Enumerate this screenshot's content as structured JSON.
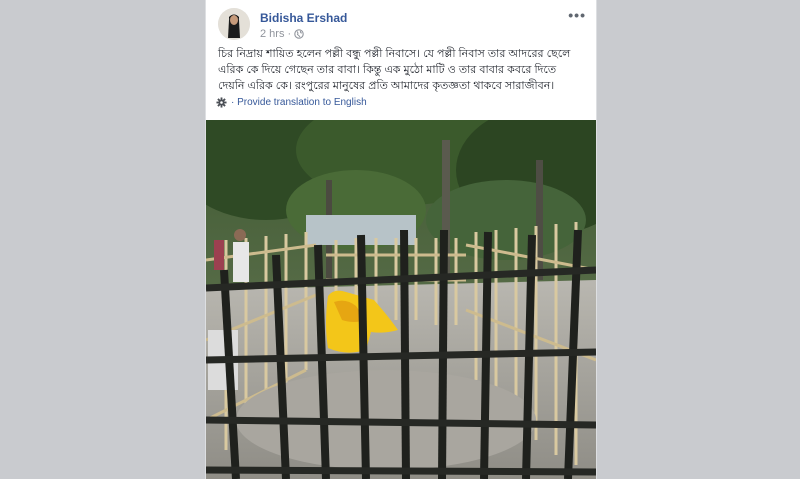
{
  "post": {
    "author": "Bidisha Ershad",
    "time": "2 hrs ·",
    "more_label": "•••",
    "text": "চির নিদ্রায় শায়িত হলেন পল্লী বন্ধু পল্লী নিবাসে। যে পল্লী নিবাস তার আদরের ছেলে এরিক কে দিয়ে গেছেন তার বাবা। কিন্তু এক মুঠো মাটি ও তার বাবার কবরে দিতে দেয়নি এরিক কে। রংপুরের মানুষের প্রতি আমাদের কৃতজ্ঞতা থাকবে সারাজীবন।",
    "translate_label": "· Provide translation to English"
  },
  "icons": {
    "avatar": "avatar-person",
    "privacy": "globe-icon",
    "more": "more-options-icon",
    "translate": "gear-icon"
  },
  "photo": {
    "subject": "bamboo-fenced-grave-with-yellow-cloth"
  },
  "colors": {
    "page_bg": "#c9cbcf",
    "card_bg": "#ffffff",
    "link": "#365899",
    "meta": "#90949c"
  }
}
